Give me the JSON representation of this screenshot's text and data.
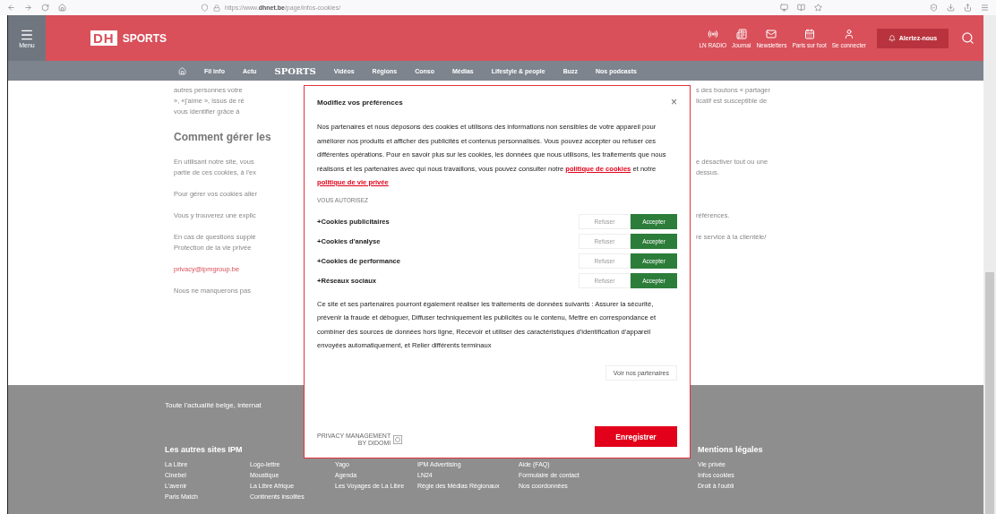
{
  "browser": {
    "url_prefix": "https://www.",
    "url_domain": "dhnet.be",
    "url_path": "/page/infos-cookies/"
  },
  "header": {
    "menu_label": "Menu",
    "logo_letters": "DH",
    "logo_section": "SPORTS",
    "tools": [
      {
        "kind": "radio",
        "label": "LN RADIO"
      },
      {
        "kind": "journal",
        "label": "Journal"
      },
      {
        "kind": "mail",
        "label": "Newsletters"
      },
      {
        "kind": "calendar",
        "label": "Paris sur foot"
      },
      {
        "kind": "user",
        "label": "Se connecter"
      }
    ],
    "alert_button": "Alertez-nous"
  },
  "nav": [
    {
      "kind": "text",
      "label": "Fil info"
    },
    {
      "kind": "text",
      "label": "Actu"
    },
    {
      "kind": "brand",
      "label": "SPORTS"
    },
    {
      "kind": "text",
      "label": "Vidéos"
    },
    {
      "kind": "text",
      "label": "Régions"
    },
    {
      "kind": "text",
      "label": "Conso"
    },
    {
      "kind": "text",
      "label": "Médias"
    },
    {
      "kind": "text",
      "label": "Lifestyle & people"
    },
    {
      "kind": "text",
      "label": "Buzz"
    },
    {
      "kind": "text",
      "label": "Nos podcasts"
    }
  ],
  "article": [
    {
      "kind": "text",
      "left": [
        "autres personnes votre",
        "», «j'aime », issus de ré",
        "vous identifier grâce à"
      ],
      "right": [
        "s des boutons « partager",
        "licatif est susceptible de"
      ]
    },
    {
      "kind": "heading",
      "left": [
        "Comment gérer les"
      ]
    },
    {
      "kind": "text",
      "left": [
        "En utilisant notre site, vous",
        "partie de ces cookies, à l'ex"
      ],
      "right": [
        "e désactiver tout ou une",
        "dessus."
      ]
    },
    {
      "kind": "text",
      "left": [
        "Pour gérer vos cookies aller"
      ]
    },
    {
      "kind": "text",
      "left": [
        "Vous y trouverez une explic"
      ],
      "right": [
        "références."
      ]
    },
    {
      "kind": "text",
      "left": [
        "En cas de questions supplé",
        "Protection de la vie privée"
      ],
      "right": [
        "re service à la clientèle/"
      ]
    },
    {
      "kind": "email",
      "left": [
        "privacy@ipmgroup.be"
      ]
    },
    {
      "kind": "text",
      "left": [
        "Nous ne manquerons pas"
      ]
    }
  ],
  "footer": {
    "tagline": "Toute l'actualité belge, internat",
    "sites_title": "Les autres sites IPM",
    "legal_title": "Mentions légales",
    "columns": [
      [
        "La Libre",
        "Cinebel",
        "L'avenir",
        "Paris Match"
      ],
      [
        "Logo-lettre",
        "Moustique",
        "La Libre Afrique",
        "Continents insolites"
      ],
      [
        "Yago",
        "Agenda",
        "Les Voyages de La Libre"
      ],
      [
        "IPM Advertising",
        "LN24",
        "Régie des Médias Régionaux"
      ],
      [
        "Aide (FAQ)",
        "Formulaire de contact",
        "Nos coordonnées"
      ],
      [
        "Vie privée",
        "Infos cookies",
        "Droit à l'oubli"
      ]
    ]
  },
  "modal": {
    "title": "Modifiez vos préférences",
    "close": "×",
    "intro": [
      {
        "kind": "text",
        "text": "Nos partenaires et nous déposons des cookies et utilisons des informations non sensibles de votre appareil pour améliorer nos produits et afficher des publicités et contenus personnalisés. Vous pouvez accepter ou refuser ces différentes opérations. Pour en savoir plus sur les cookies, les données que nous utilisons, les traitements que nous réalisons et les partenaires avec qui nous travaillons, vous pouvez consulter notre "
      },
      {
        "kind": "link",
        "text": "politique de cookies"
      },
      {
        "kind": "text",
        "text": " et notre "
      },
      {
        "kind": "link",
        "text": "politique de vie privée"
      }
    ],
    "section_label": "VOUS AUTORISEZ",
    "purposes": [
      {
        "expander": "+",
        "name": "Cookies publicitaires",
        "refuse": "Refuser",
        "accept": "Accepter",
        "accepted": true
      },
      {
        "expander": "+",
        "name": "Cookies d'analyse",
        "refuse": "Refuser",
        "accept": "Accepter",
        "accepted": true
      },
      {
        "expander": "+",
        "name": "Cookies de performance",
        "refuse": "Refuser",
        "accept": "Accepter",
        "accepted": true
      },
      {
        "expander": "+",
        "name": "Réseaux sociaux",
        "refuse": "Refuser",
        "accept": "Accepter",
        "accepted": true
      }
    ],
    "processing": "Ce site et ses partenaires pourront également réaliser les traitements de données suivants : Assurer la sécurité, prévenir la fraude et déboguer, Diffuser techniquement les publicités ou le contenu, Mettre en correspondance et combiner des sources de données hors ligne, Recevoir et utiliser des caractéristiques d'identification d'appareil envoyées automatiquement, et Relier différents terminaux",
    "partners_button": "Voir nos partenaires",
    "badge_line1": "PRIVACY MANAGEMENT",
    "badge_line2": "BY DIDOMI",
    "save_button": "Enregistrer"
  }
}
